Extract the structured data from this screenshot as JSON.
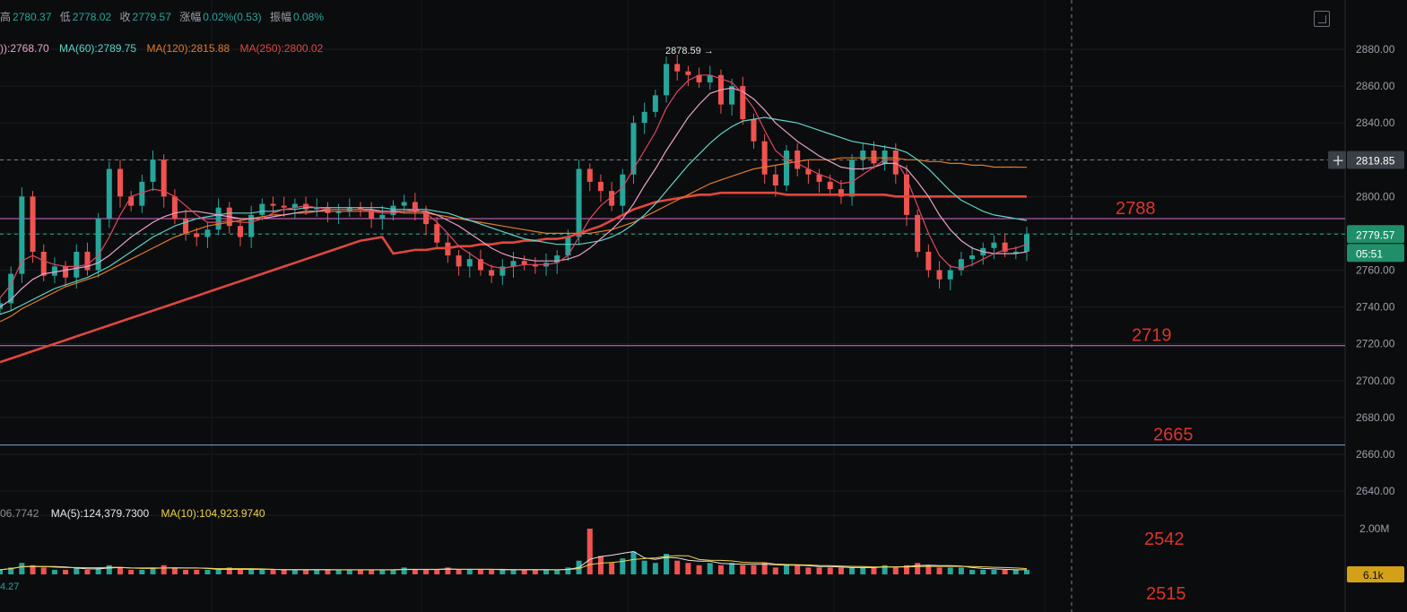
{
  "header": {
    "high_label": "高",
    "high": "2780.37",
    "low_label": "低",
    "low": "2778.02",
    "close_label": "收",
    "close": "2779.57",
    "change_label": "涨幅",
    "change": "0.02%(0.53)",
    "amplitude_label": "振幅",
    "amplitude": "0.08%"
  },
  "ma_legend": [
    {
      "text": ")):2768.70",
      "color": "#e9a1c8"
    },
    {
      "text": "MA(60):2789.75",
      "color": "#5fd4c6"
    },
    {
      "text": "MA(120):2815.88",
      "color": "#e37a2a"
    },
    {
      "text": "MA(250):2800.02",
      "color": "#e0473e"
    }
  ],
  "volume_legend": [
    {
      "text": "06.7742",
      "color": "#8a8f96"
    },
    {
      "text": "MA(5):124,379.7300",
      "color": "#e6e6e6"
    },
    {
      "text": "MA(10):104,923.9740",
      "color": "#f0d24a"
    }
  ],
  "volume_tail": "4.27",
  "price_tags": {
    "crosshair": "2819.85",
    "last": "2779.57",
    "countdown": "05:51",
    "volume_last": "6.1k",
    "peak_annotation": "2878.59 →"
  },
  "colors": {
    "up": "#26a69a",
    "down": "#ef5350",
    "ma_short": "#e0475f",
    "ma_mid": "#e9a1c8",
    "ma60": "#5fd4c6",
    "ma120": "#e37a2a",
    "ma250": "#e0473e",
    "level_line": "#d96bd0",
    "level_line_blue": "#7fa7d9",
    "level_text": "#e0322c",
    "axis_text": "#9aa0a6",
    "last_tag": "#1f8f6a"
  },
  "chart_data": {
    "type": "candlestick",
    "yaxis_ticks": [
      "2880.00",
      "2860.00",
      "2840.00",
      "2820.00",
      "2800.00",
      "2780.00",
      "2760.00",
      "2740.00",
      "2720.00",
      "2700.00",
      "2680.00",
      "2660.00",
      "2640.00"
    ],
    "volume_axis_ticks": [
      "2.00M"
    ],
    "ylim": [
      2626,
      2888
    ],
    "level_lines": [
      {
        "value": 2788,
        "label": "2788",
        "color": "pink"
      },
      {
        "value": 2719,
        "label": "2719",
        "color": "pink"
      },
      {
        "value": 2665,
        "label": "2665",
        "color": "blue"
      }
    ],
    "extra_levels": [
      "2542",
      "2515"
    ],
    "dashed_levels": [
      2819.85,
      2779.57
    ],
    "close_path": [
      2742,
      2758,
      2800,
      2770,
      2757,
      2762,
      2756,
      2770,
      2760,
      2788,
      2815,
      2800,
      2795,
      2808,
      2820,
      2800,
      2788,
      2780,
      2778,
      2782,
      2794,
      2784,
      2778,
      2790,
      2796,
      2795,
      2794,
      2796,
      2793,
      2794,
      2791,
      2792,
      2794,
      2793,
      2788,
      2790,
      2795,
      2797,
      2792,
      2785,
      2775,
      2768,
      2762,
      2766,
      2760,
      2757,
      2762,
      2765,
      2763,
      2762,
      2764,
      2768,
      2778,
      2815,
      2808,
      2803,
      2795,
      2812,
      2840,
      2846,
      2855,
      2872,
      2868,
      2866,
      2862,
      2866,
      2850,
      2860,
      2842,
      2830,
      2812,
      2806,
      2825,
      2815,
      2812,
      2808,
      2804,
      2800,
      2820,
      2825,
      2818,
      2825,
      2812,
      2790,
      2770,
      2760,
      2755,
      2760,
      2766,
      2768,
      2772,
      2775,
      2770,
      2770,
      2779.57
    ],
    "ma_short": [
      2745,
      2752,
      2765,
      2768,
      2765,
      2763,
      2762,
      2762,
      2763,
      2768,
      2778,
      2790,
      2800,
      2802,
      2804,
      2803,
      2800,
      2795,
      2790,
      2786,
      2786,
      2787,
      2786,
      2786,
      2788,
      2791,
      2793,
      2794,
      2795,
      2794,
      2793,
      2793,
      2793,
      2793,
      2792,
      2791,
      2791,
      2792,
      2793,
      2791,
      2786,
      2780,
      2773,
      2769,
      2765,
      2762,
      2761,
      2762,
      2763,
      2763,
      2763,
      2764,
      2768,
      2778,
      2788,
      2795,
      2800,
      2805,
      2815,
      2825,
      2835,
      2848,
      2857,
      2863,
      2866,
      2866,
      2864,
      2862,
      2856,
      2848,
      2836,
      2825,
      2820,
      2818,
      2815,
      2812,
      2810,
      2807,
      2808,
      2812,
      2816,
      2820,
      2820,
      2810,
      2795,
      2780,
      2768,
      2762,
      2761,
      2763,
      2766,
      2769,
      2771,
      2772,
      2774
    ],
    "ma_mid": [
      2740,
      2744,
      2750,
      2755,
      2758,
      2759,
      2760,
      2761,
      2762,
      2764,
      2768,
      2773,
      2778,
      2782,
      2786,
      2789,
      2791,
      2792,
      2792,
      2791,
      2790,
      2789,
      2788,
      2788,
      2788,
      2789,
      2790,
      2791,
      2792,
      2792,
      2793,
      2793,
      2793,
      2793,
      2793,
      2792,
      2792,
      2792,
      2792,
      2792,
      2790,
      2787,
      2784,
      2780,
      2776,
      2772,
      2769,
      2767,
      2766,
      2765,
      2765,
      2765,
      2766,
      2768,
      2772,
      2777,
      2782,
      2788,
      2796,
      2806,
      2815,
      2825,
      2834,
      2843,
      2850,
      2856,
      2858,
      2859,
      2857,
      2853,
      2847,
      2840,
      2835,
      2830,
      2826,
      2822,
      2819,
      2816,
      2815,
      2815,
      2816,
      2818,
      2818,
      2815,
      2808,
      2800,
      2790,
      2782,
      2776,
      2772,
      2770,
      2769,
      2769,
      2769,
      2770
    ],
    "ma60": [
      2736,
      2738,
      2741,
      2744,
      2747,
      2750,
      2752,
      2754,
      2756,
      2759,
      2762,
      2766,
      2770,
      2774,
      2778,
      2781,
      2784,
      2786,
      2788,
      2789,
      2790,
      2791,
      2791,
      2791,
      2792,
      2792,
      2793,
      2793,
      2794,
      2794,
      2794,
      2794,
      2794,
      2794,
      2794,
      2794,
      2793,
      2793,
      2793,
      2793,
      2792,
      2791,
      2789,
      2787,
      2785,
      2783,
      2781,
      2779,
      2777,
      2776,
      2775,
      2774,
      2774,
      2774,
      2775,
      2776,
      2778,
      2781,
      2785,
      2790,
      2796,
      2803,
      2810,
      2817,
      2823,
      2829,
      2834,
      2838,
      2841,
      2842,
      2843,
      2842,
      2841,
      2840,
      2838,
      2836,
      2834,
      2832,
      2830,
      2829,
      2828,
      2827,
      2826,
      2824,
      2820,
      2815,
      2809,
      2803,
      2798,
      2795,
      2792,
      2790,
      2789,
      2788,
      2787
    ],
    "ma120": [
      2732,
      2735,
      2739,
      2742,
      2745,
      2748,
      2751,
      2753,
      2755,
      2757,
      2760,
      2763,
      2766,
      2769,
      2772,
      2775,
      2778,
      2780,
      2782,
      2784,
      2785,
      2786,
      2787,
      2788,
      2789,
      2790,
      2790,
      2791,
      2791,
      2792,
      2792,
      2792,
      2792,
      2792,
      2792,
      2792,
      2792,
      2791,
      2791,
      2791,
      2790,
      2789,
      2788,
      2787,
      2786,
      2785,
      2784,
      2783,
      2782,
      2781,
      2780,
      2780,
      2780,
      2780,
      2780,
      2781,
      2782,
      2784,
      2786,
      2789,
      2792,
      2795,
      2798,
      2801,
      2804,
      2807,
      2809,
      2811,
      2813,
      2815,
      2816,
      2817,
      2818,
      2819,
      2820,
      2820,
      2820,
      2821,
      2821,
      2821,
      2821,
      2821,
      2821,
      2820,
      2820,
      2819,
      2819,
      2818,
      2818,
      2817,
      2817,
      2816,
      2816,
      2816,
      2815.88
    ],
    "ma250": [
      2710,
      2712,
      2714,
      2716,
      2718,
      2720,
      2722,
      2724,
      2726,
      2728,
      2730,
      2732,
      2734,
      2736,
      2738,
      2740,
      2742,
      2744,
      2746,
      2748,
      2750,
      2752,
      2754,
      2756,
      2758,
      2760,
      2762,
      2764,
      2766,
      2768,
      2770,
      2772,
      2774,
      2776,
      2777,
      2778,
      2769,
      2770,
      2771,
      2771,
      2772,
      2772,
      2773,
      2773,
      2774,
      2774,
      2775,
      2775,
      2776,
      2776,
      2777,
      2777,
      2778,
      2780,
      2782,
      2784,
      2787,
      2790,
      2793,
      2795,
      2797,
      2798,
      2799,
      2800,
      2801,
      2801,
      2802,
      2802,
      2802,
      2802,
      2802,
      2802,
      2801,
      2801,
      2801,
      2801,
      2801,
      2801,
      2801,
      2801,
      2801,
      2801,
      2800,
      2800,
      2800,
      2800,
      2800,
      2800,
      2800,
      2800,
      2800,
      2800,
      2800,
      2800,
      2800.02
    ],
    "volume_profile": [
      0.2,
      0.3,
      0.5,
      0.4,
      0.3,
      0.2,
      0.2,
      0.3,
      0.2,
      0.3,
      0.4,
      0.3,
      0.2,
      0.2,
      0.3,
      0.4,
      0.3,
      0.2,
      0.2,
      0.2,
      0.2,
      0.3,
      0.2,
      0.2,
      0.2,
      0.2,
      0.2,
      0.2,
      0.2,
      0.2,
      0.2,
      0.2,
      0.2,
      0.2,
      0.2,
      0.2,
      0.2,
      0.3,
      0.2,
      0.2,
      0.2,
      0.3,
      0.2,
      0.2,
      0.2,
      0.2,
      0.2,
      0.2,
      0.2,
      0.2,
      0.2,
      0.2,
      0.3,
      0.6,
      2.0,
      0.8,
      0.5,
      0.7,
      1.0,
      0.6,
      0.5,
      0.9,
      0.6,
      0.5,
      0.4,
      0.5,
      0.4,
      0.5,
      0.4,
      0.4,
      0.5,
      0.3,
      0.4,
      0.4,
      0.3,
      0.3,
      0.3,
      0.3,
      0.3,
      0.3,
      0.3,
      0.4,
      0.3,
      0.4,
      0.5,
      0.4,
      0.3,
      0.3,
      0.3,
      0.2,
      0.2,
      0.2,
      0.2,
      0.2,
      0.2
    ]
  }
}
